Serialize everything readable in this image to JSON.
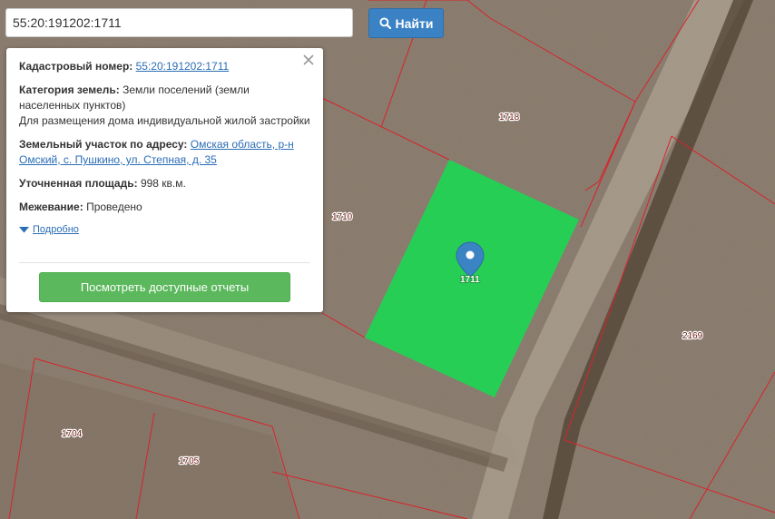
{
  "search": {
    "value": "55:20:191202:1711",
    "button_label": "Найти"
  },
  "info": {
    "cadastral_label": "Кадастровый номер:",
    "cadastral_value": "55:20:191202:1711",
    "category_label": "Категория земель:",
    "category_value": "Земли поселений (земли населенных пунктов)",
    "purpose": "Для размещения дома индивидуальной жилой застройки",
    "address_label": "Земельный участок по адресу:",
    "address_value": "Омская область, р-н Омский, с. Пушкино, ул. Степная, д. 35",
    "area_label": "Уточненная площадь:",
    "area_value": "998 кв.м.",
    "survey_label": "Межевание:",
    "survey_value": "Проведено",
    "details_label": "Подробно",
    "reports_button": "Посмотреть доступные отчеты"
  },
  "map": {
    "parcel_labels": {
      "p1718": "1718",
      "p1710": "1710",
      "p2169": "2169",
      "p1704": "1704",
      "p1705": "1705",
      "p1711": "1711"
    }
  },
  "colors": {
    "selected_parcel": "#22d353",
    "parcel_border": "#d8232a",
    "search_button": "#3a82c4",
    "reports_button": "#5cb85c",
    "marker": "#3b84c4"
  },
  "icons": {
    "search": "search-icon",
    "close": "close-icon",
    "details": "caret-down-icon",
    "marker": "map-marker-icon"
  }
}
